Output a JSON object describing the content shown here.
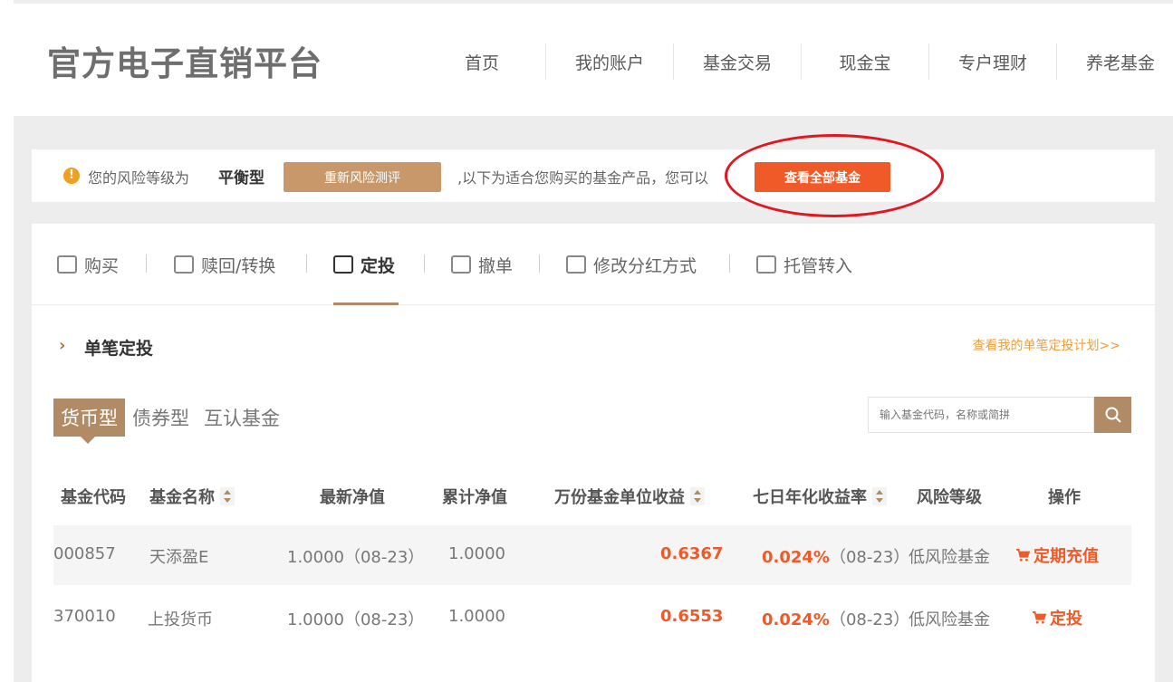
{
  "header": {
    "logo": "官方电子直销平台",
    "nav": [
      "首页",
      "我的账户",
      "基金交易",
      "现金宝",
      "专户理财",
      "养老基金"
    ]
  },
  "risk_bar": {
    "label": "您的风险等级为",
    "value": "平衡型",
    "reeval_button": "重新风险测评",
    "text": ",以下为适合您购买的基金产品，您可以",
    "view_all_button": "查看全部基金"
  },
  "tabs": [
    {
      "label": "购买",
      "icon": "purchase-icon"
    },
    {
      "label": "赎回/转换",
      "icon": "redeem-icon"
    },
    {
      "label": "定投",
      "icon": "fixed-invest-icon"
    },
    {
      "label": "撤单",
      "icon": "cancel-order-icon"
    },
    {
      "label": "修改分红方式",
      "icon": "edit-dividend-icon"
    },
    {
      "label": "托管转入",
      "icon": "custody-transfer-icon"
    }
  ],
  "active_tab": "定投",
  "section": {
    "title": "单笔定投",
    "plan_link": "查看我的单笔定投计划>>"
  },
  "fund_tabs": [
    "货币型",
    "债券型",
    "互认基金"
  ],
  "search": {
    "placeholder": "输入基金代码，名称或简拼"
  },
  "table": {
    "headers": [
      "基金代码",
      "基金名称",
      "最新净值",
      "累计净值",
      "万份基金单位收益",
      "七日年化收益率",
      "风险等级",
      "操作"
    ],
    "rows": [
      {
        "code": "000857",
        "name": "天添盈E",
        "nav": "1.0000（08-23）",
        "acc_nav": "1.0000",
        "unit_income": "0.6367",
        "yield_value": "0.024%",
        "yield_date": "（08-23）",
        "risk": "低风险基金",
        "action": "定期充值"
      },
      {
        "code": "370010",
        "name": "上投货币",
        "nav": "1.0000（08-23）",
        "acc_nav": "1.0000",
        "unit_income": "0.6553",
        "yield_value": "0.024%",
        "yield_date": "（08-23）",
        "risk": "低风险基金",
        "action": "定投"
      }
    ]
  },
  "colors": {
    "accent": "#b08b66",
    "highlight": "#f05a28",
    "annotation": "#e1161e"
  }
}
